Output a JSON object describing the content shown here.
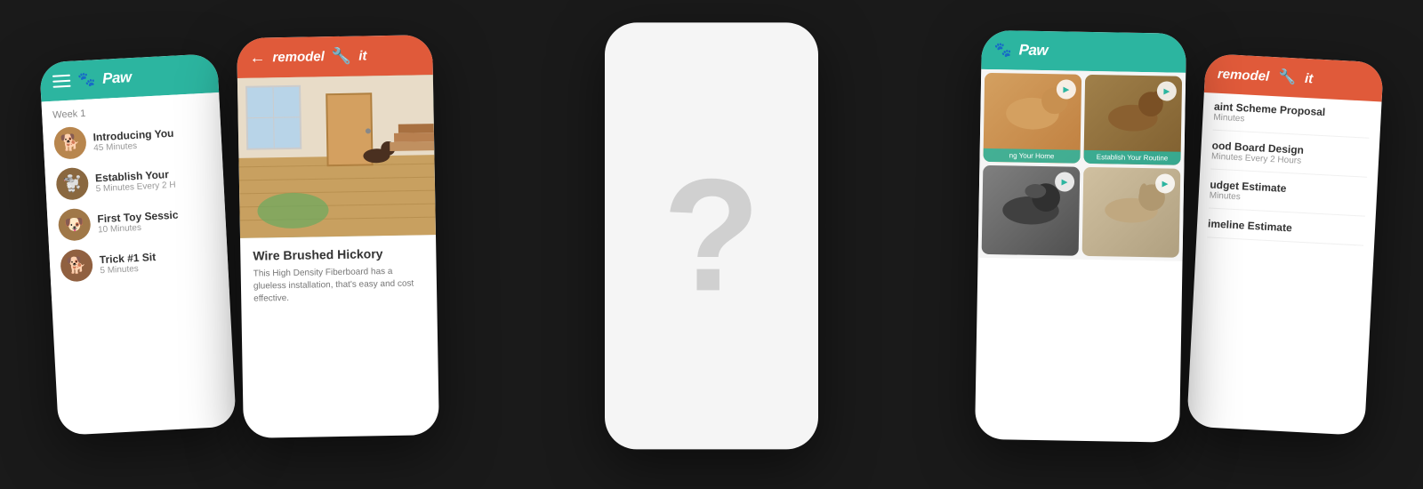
{
  "phones": {
    "farLeft": {
      "appName": "Paw",
      "weekLabel": "Week 1",
      "items": [
        {
          "title": "Introducing You",
          "sub": "45 Minutes",
          "dogColor": "b8864e"
        },
        {
          "title": "Establish Your",
          "sub": "5 Minutes Every 2 H",
          "dogColor": "8a6840"
        },
        {
          "title": "First Toy Sessic",
          "sub": "10 Minutes",
          "dogColor": "a07848"
        },
        {
          "title": "Trick #1 Sit",
          "sub": "5 Minutes",
          "dogColor": "906040"
        }
      ]
    },
    "midLeft": {
      "appName": "remodel it",
      "articleTitle": "Wire Brushed Hickory",
      "articleDesc": "This High Density Fiberboard has a glueless installation, that's easy and cost effective."
    },
    "center": {
      "questionMark": "?"
    },
    "midRight": {
      "appName": "Paw",
      "videos": [
        {
          "label": "ng Your Home",
          "bg": "1"
        },
        {
          "label": "Establish Your Routine",
          "bg": "2"
        },
        {
          "label": "",
          "bg": "3"
        },
        {
          "label": "",
          "bg": "4"
        }
      ]
    },
    "farRight": {
      "appName": "remodel it",
      "items": [
        {
          "title": "aint Scheme Proposal",
          "sub": "Minutes"
        },
        {
          "title": "ood Board Design",
          "sub": "Minutes Every 2 Hours"
        },
        {
          "title": "udget Estimate",
          "sub": "Minutes"
        },
        {
          "title": "imeline Estimate",
          "sub": ""
        }
      ]
    }
  },
  "icons": {
    "hamburger": "☰",
    "back": "←",
    "paw": "🐾",
    "play": "▶",
    "dog1": "🐕",
    "dog2": "🐩",
    "dog3": "🐾"
  }
}
